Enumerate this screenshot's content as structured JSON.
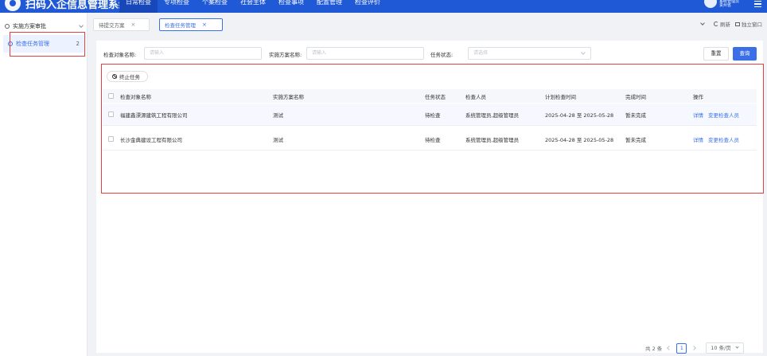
{
  "app": {
    "title": "扫码入企信息管理系统"
  },
  "nav": {
    "items": [
      "日常检查",
      "专项检查",
      "个案检查",
      "社会主体",
      "检查事项",
      "配置管理",
      "检查评价"
    ],
    "active_index": 0
  },
  "user": {
    "role": "系统管理员",
    "region": "贵州省"
  },
  "sidebar": {
    "parent_label": "实施方案审批",
    "child_label": "检查任务管理",
    "child_count": "2"
  },
  "tabs": [
    {
      "label": "待提交方案"
    },
    {
      "label": "检查任务管理"
    }
  ],
  "tabs_right": {
    "refresh": "刷新",
    "standalone": "独立窗口"
  },
  "filter": {
    "target_label": "检查对象名称:",
    "target_placeholder": "请输入",
    "plan_label": "实施方案名称:",
    "plan_placeholder": "请输入",
    "status_label": "任务状态:",
    "status_placeholder": "请选择",
    "reset": "重置",
    "search": "查询"
  },
  "toolbar": {
    "stop_task": "终止任务"
  },
  "table": {
    "columns": [
      "检查对象名称",
      "实施方案名称",
      "任务状态",
      "检查人员",
      "计划检查时间",
      "完成时间",
      "操作"
    ],
    "rows": [
      {
        "target": "福建鑫漂源建筑工程有限公司",
        "plan": "测试",
        "status": "待检查",
        "inspectors": "系统管理员,超级管理员",
        "planned": "2025-04-28 至 2025-05-28",
        "done": "暂未完成",
        "op_detail": "详情",
        "op_change": "变更检查人员"
      },
      {
        "target": "长沙金典建设工程有限公司",
        "plan": "测试",
        "status": "待检查",
        "inspectors": "系统管理员,超级管理员",
        "planned": "2025-04-28 至 2025-05-28",
        "done": "暂未完成",
        "op_detail": "详情",
        "op_change": "变更检查人员"
      }
    ]
  },
  "pagination": {
    "total": "共 2 条",
    "current_page": "1",
    "page_size": "10 条/页"
  }
}
